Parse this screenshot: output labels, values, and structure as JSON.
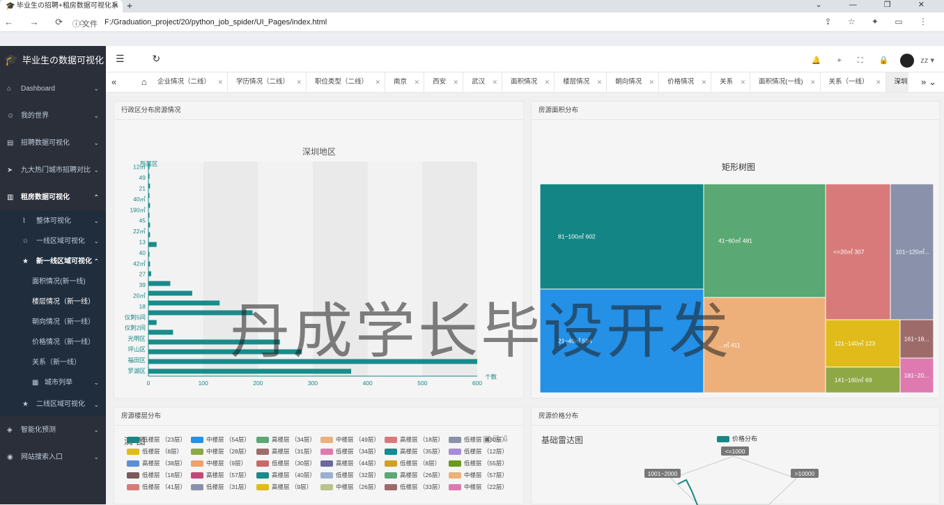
{
  "browser": {
    "tab_title": "毕业生の招聘+租房数据可视化系",
    "new_tab": "+",
    "window_controls": "⌄ — ❐ ✕",
    "nav": "← → ⟳ ⌂",
    "file_label": "ⓘ 文件",
    "url": "F:/Graduation_project/20/python_job_spider/UI_Pages/index.html",
    "tools": "⇪ ☆ ✦ ▭ ⋮"
  },
  "sidebar": {
    "title": "毕业生の数据可视化",
    "items": [
      {
        "label": "Dashboard",
        "icon": "⌂",
        "arrow": "⌄"
      },
      {
        "label": "我的世界",
        "icon": "☺",
        "arrow": "⌄"
      },
      {
        "label": "招聘数据可视化",
        "icon": "▤",
        "arrow": "⌄"
      },
      {
        "label": "九大热门城市招聘对比",
        "icon": "➤",
        "arrow": "⌄"
      },
      {
        "label": "租房数据可视化",
        "icon": "▥",
        "arrow": "⌃"
      }
    ],
    "sub": [
      {
        "label": "整体可视化",
        "icon": "⌇",
        "arrow": "⌄"
      },
      {
        "label": "一线区域可视化",
        "icon": "☆",
        "arrow": "⌄"
      },
      {
        "label": "新一线区域可视化",
        "icon": "★",
        "arrow": "⌃"
      }
    ],
    "leaves": [
      "面积情况(新一线)",
      "楼层情况（新一线）",
      "朝向情况（新一线）",
      "价格情况（新一线）",
      "关系（新一线）"
    ],
    "city_list": {
      "label": "城市列举",
      "icon": "▦",
      "arrow": "⌄"
    },
    "second_tier": {
      "label": "二线区域可视化",
      "icon": "★",
      "arrow": "⌄"
    },
    "bottom": [
      {
        "label": "智能化预测",
        "icon": "◈",
        "arrow": "⌄"
      },
      {
        "label": "网站搜索入口",
        "icon": "◉",
        "arrow": "⌄"
      }
    ]
  },
  "topnav": {
    "menu": "☰ ↻",
    "bell": "🔔",
    "tag": "⌖",
    "full": "⛶",
    "lock": "🔒",
    "user": "zz ▾"
  },
  "tags": {
    "left": "« ⌂",
    "right": "» ⌄",
    "items": [
      "企业情况（二线）",
      "学历情况（二线）",
      "职位类型（二线）",
      "南京",
      "西安",
      "武汉",
      "面积情况",
      "楼层情况",
      "朝向情况",
      "价格情况",
      "关系",
      "面积情况(一线)",
      "关系（一线）",
      "深圳"
    ],
    "active": "深圳"
  },
  "cards": {
    "c1": {
      "title": "行政区分布房源情况",
      "chart_title": "深圳地区",
      "y_name": "所属区",
      "x_name": "个数"
    },
    "c2": {
      "title": "房源面积分布",
      "chart_title": "矩形树图"
    },
    "c3": {
      "title": "房源楼层分布",
      "toolbar": "▣ ⎘ ⇩"
    },
    "c4": {
      "title": "房源价格分布",
      "chart_title": "基础雷达图",
      "legend": "价格分布",
      "labels": [
        "<=1000",
        "1001~2000",
        ">10000"
      ]
    }
  },
  "chart_data": [
    {
      "type": "bar",
      "title": "深圳地区",
      "orientation": "horizontal",
      "categories": [
        "罗湖区",
        "福田区",
        "坪山区",
        "光明区",
        "仪刺2间",
        "仪刺5间",
        "18",
        "20㎡",
        "39",
        "27",
        "42㎡",
        "40",
        "13",
        "22㎡",
        "45",
        "190㎡",
        "40㎡",
        "21",
        "49",
        "12㎡"
      ],
      "values": [
        370,
        600,
        280,
        240,
        45,
        15,
        190,
        130,
        80,
        40,
        5,
        3,
        2,
        15,
        3,
        3,
        2,
        3,
        2,
        3,
        2,
        2
      ],
      "xlim": [
        0,
        600
      ],
      "xticks": [
        0,
        100,
        200,
        300,
        400,
        500,
        600
      ],
      "xlabel": "个数",
      "ylabel": "所属区",
      "bar_color": "#1a8b8b"
    },
    {
      "type": "treemap",
      "title": "矩形树图",
      "nodes": [
        {
          "name": "81~100㎡",
          "value": 602,
          "color": "#148585"
        },
        {
          "name": "41~60㎡",
          "value": 481,
          "color": "#5aa873"
        },
        {
          "name": "<=20㎡",
          "value": 307,
          "color": "#d97a7a"
        },
        {
          "name": "101~120㎡",
          "value": null,
          "label": "101~120㎡...",
          "color": "#8992aa"
        },
        {
          "name": "21~40㎡",
          "value": 594,
          "color": "#2490e6"
        },
        {
          "name": "61~80㎡",
          "value": 411,
          "label": "...㎡ 411",
          "color": "#edb07a"
        },
        {
          "name": "121~140㎡",
          "value": 123,
          "color": "#e0bb1a"
        },
        {
          "name": "161~18...",
          "value": null,
          "color": "#9e6b6b"
        },
        {
          "name": "141~160㎡",
          "value": 69,
          "color": "#8ea846"
        },
        {
          "name": "181~20...",
          "value": null,
          "color": "#df7ab0"
        }
      ]
    }
  ],
  "floor_legend": [
    {
      "label": "低楼层 （23层）",
      "color": "#1a8585"
    },
    {
      "label": "中楼层 （54层）",
      "color": "#2490e6"
    },
    {
      "label": "高楼层 （34层）",
      "color": "#5aa873"
    },
    {
      "label": "中楼层 （49层）",
      "color": "#edb07a"
    },
    {
      "label": "高楼层 （18层）",
      "color": "#d97a7a"
    },
    {
      "label": "低楼层 （30层）",
      "color": "#8992aa"
    },
    {
      "label": "低楼层 （8层）",
      "color": "#e0bb1a"
    },
    {
      "label": "中楼层 （28层）",
      "color": "#8ea846"
    },
    {
      "label": "高楼层 （31层）",
      "color": "#9e6b6b"
    },
    {
      "label": "低楼层 （34层）",
      "color": "#df7ab0"
    },
    {
      "label": "高楼层 （35层）",
      "color": "#148a94"
    },
    {
      "label": "低楼层 （12层）",
      "color": "#a98bd6"
    },
    {
      "label": "高楼层 （38层）",
      "color": "#5b8ed6"
    },
    {
      "label": "中楼层 （9层）",
      "color": "#f0a068"
    },
    {
      "label": "低楼层 （30层）",
      "color": "#c86a6a"
    },
    {
      "label": "高楼层 （44层）",
      "color": "#6a6a9e"
    },
    {
      "label": "低楼层 （8层）",
      "color": "#d0a020"
    },
    {
      "label": "低楼层 （55层）",
      "color": "#6a9a1a"
    },
    {
      "label": "低楼层 （18层）",
      "color": "#7a5a5a"
    },
    {
      "label": "高楼层 （57层）",
      "color": "#c04a7a"
    },
    {
      "label": "高楼层 （40层）",
      "color": "#1a8a8a"
    },
    {
      "label": "低楼层 （32层）",
      "color": "#9ab0d0"
    },
    {
      "label": "高楼层 （26层）",
      "color": "#5aa873"
    },
    {
      "label": "中楼层 （57层）",
      "color": "#edb07a"
    },
    {
      "label": "低楼层 （41层）",
      "color": "#d97a7a"
    },
    {
      "label": "低楼层 （31层）",
      "color": "#8992aa"
    },
    {
      "label": "高楼层 （9层）",
      "color": "#e0bb1a"
    },
    {
      "label": "中楼层 （26层）",
      "color": "#b8c48a"
    },
    {
      "label": "低楼层 （33层）",
      "color": "#9e6b6b"
    },
    {
      "label": "中楼层 （22层）",
      "color": "#df7ab0"
    }
  ],
  "watermark": "丹成学长毕设开发"
}
